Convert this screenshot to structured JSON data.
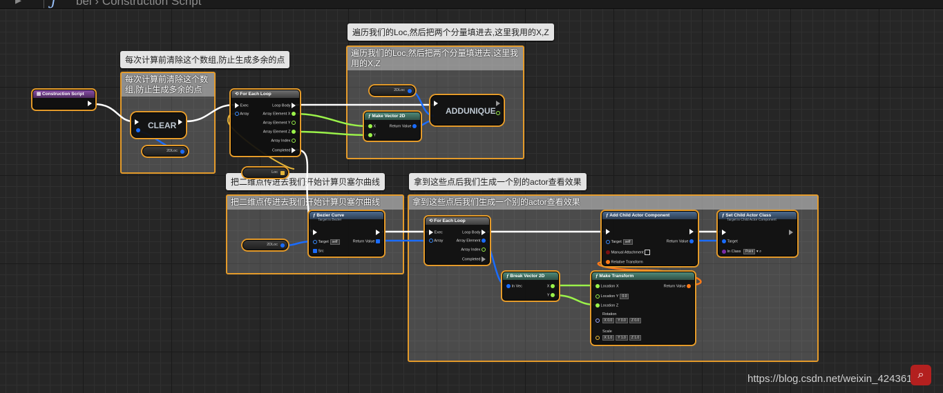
{
  "topbar": {
    "nav_icon": "arrow-right-icon",
    "function_icon": "function-icon",
    "breadcrumb_prefix": "bei",
    "breadcrumb_separator": "›",
    "breadcrumb_current": "Construction Script"
  },
  "comments": {
    "clear": {
      "text": "每次计算前清除这个数组,防止生成多余的点"
    },
    "loop": {
      "text": "遍历我们的Loc,然后把两个分量填进去,这里我用的X,Z"
    },
    "bezier": {
      "text": "把二维点传进去我们开始计算贝塞尔曲线"
    },
    "spawn": {
      "text": "拿到这些点后我们生成一个别的actor查看效果"
    }
  },
  "nodes": {
    "construction_script": {
      "title": "Construction Script"
    },
    "clear": {
      "title": "CLEAR"
    },
    "for_each_1": {
      "title": "For Each Loop",
      "exec": "Exec",
      "array": "Array",
      "loop_body": "Loop Body",
      "elem_x": "Array Element X",
      "elem_y": "Array Element Y",
      "elem_z": "Array Element Z",
      "index": "Array Index",
      "completed": "Completed"
    },
    "make_vector2d": {
      "title": "Make Vector 2D",
      "x": "X",
      "y": "Y",
      "ret": "Return Value"
    },
    "addunique": {
      "title": "ADDUNIQUE"
    },
    "bezier_curve": {
      "title": "Bezier Curve",
      "subtitle": "Target is Bezier",
      "target": "Target",
      "target_val": "self",
      "src": "Src",
      "ret": "Return Value"
    },
    "for_each_2": {
      "title": "For Each Loop",
      "exec": "Exec",
      "array": "Array",
      "loop_body": "Loop Body",
      "elem": "Array Element",
      "index": "Array Index",
      "completed": "Completed"
    },
    "add_child": {
      "title": "Add Child Actor Component",
      "target": "Target",
      "target_val": "self",
      "manual": "Manual Attachment",
      "relative": "Relative Transform",
      "ret": "Return Value"
    },
    "set_child_class": {
      "title": "Set Child Actor Class",
      "subtitle": "Target is Child Actor Component",
      "target": "Target",
      "in_class": "In Class",
      "in_class_val": "Point"
    },
    "break_vector2d": {
      "title": "Break Vector 2D",
      "in_vec": "In Vec",
      "x": "X",
      "y": "Y"
    },
    "make_transform": {
      "title": "Make Transform",
      "loc_x": "Location X",
      "loc_y": "Location Y",
      "loc_y_val": "0.0",
      "loc_z": "Location Z",
      "rotation": "Rotation",
      "rot_x": "0.0",
      "rot_y": "0.0",
      "rot_z": "0.0",
      "scale": "Scale",
      "scale_x": "1.0",
      "scale_y": "1.0",
      "scale_z": "1.0",
      "ret": "Return Value",
      "axis_x": "X",
      "axis_y": "Y",
      "axis_z": "Z"
    }
  },
  "variables": {
    "twodloc_1": "2DLoc",
    "twodloc_2": "2DLoc",
    "loc": "Loc",
    "twodloc_3": "2DLoc"
  },
  "watermark": "https://blog.csdn.net/weixin_42436183",
  "colors": {
    "comment_border": "#e59b2a",
    "exec_wire": "#ffffff",
    "vector_wire": "#1a6cff",
    "float_wire": "#9bf24a",
    "transform_wire": "#ff7a18"
  }
}
